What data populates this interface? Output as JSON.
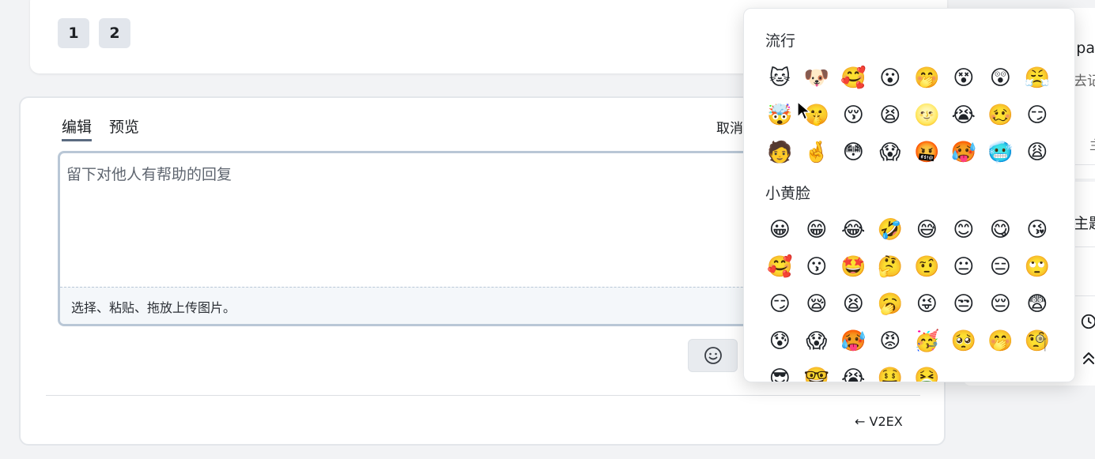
{
  "pagination": {
    "pages": [
      "1",
      "2"
    ]
  },
  "reply": {
    "tabs": [
      "编辑",
      "预览"
    ],
    "cancel_label": "取消",
    "placeholder": "留下对他人有帮助的回复",
    "upload_hint": "选择、粘贴、拖放上传图片。",
    "back_link": "← V2EX"
  },
  "sidebar": {
    "fragments": [
      "lpa",
      "去记",
      "主",
      "主题"
    ]
  },
  "emoji_panel": {
    "sections": [
      {
        "title": "流行",
        "emojis": [
          "🐱",
          "🐶",
          "🥰",
          "😮",
          "🤭",
          "😵",
          "😲",
          "😤",
          "🤯",
          "🤫",
          "😚",
          "😫",
          "🌝",
          "😭",
          "🥴",
          "😏",
          "🧑",
          "🤞",
          "😳",
          "😱",
          "🤬",
          "🥵",
          "🥶",
          "😩"
        ]
      },
      {
        "title": "小黄脸",
        "emojis": [
          "😀",
          "😁",
          "😂",
          "🤣",
          "😅",
          "😊",
          "😋",
          "😘",
          "🥰",
          "😗",
          "🤩",
          "🤔",
          "🤨",
          "😐",
          "😑",
          "🙄",
          "😏",
          "😪",
          "😫",
          "🥱",
          "😜",
          "😒",
          "😔",
          "😨",
          "😰",
          "😱",
          "🥵",
          "😡",
          "🥳",
          "🥺",
          "🤭",
          "🧐",
          "😎",
          "🤓",
          "😭",
          "🤑",
          "🤮"
        ]
      }
    ]
  },
  "colors": {
    "accent": "#5b6b80",
    "page_bg": "#f2f3f5",
    "editor_border": "#b9c7d6",
    "page_button_bg": "#e2e6ec"
  }
}
